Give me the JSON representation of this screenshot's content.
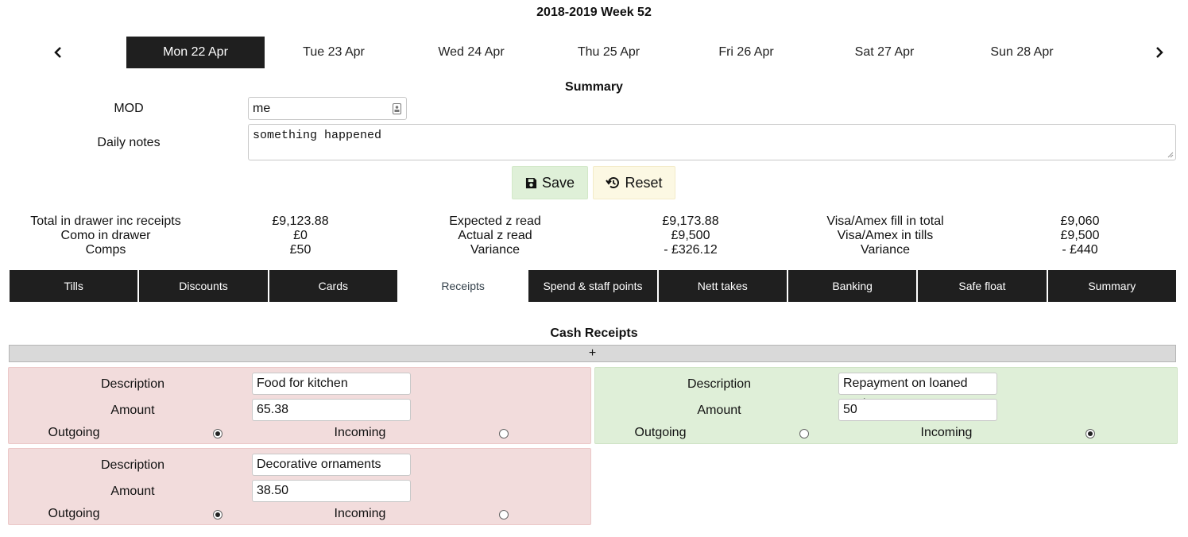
{
  "header": {
    "title": "2018-2019 Week 52"
  },
  "days": [
    {
      "label": "Mon 22 Apr"
    },
    {
      "label": "Tue 23 Apr"
    },
    {
      "label": "Wed 24 Apr"
    },
    {
      "label": "Thu 25 Apr"
    },
    {
      "label": "Fri 26 Apr"
    },
    {
      "label": "Sat 27 Apr"
    },
    {
      "label": "Sun 28 Apr"
    }
  ],
  "summary": {
    "heading": "Summary",
    "mod_label": "MOD",
    "mod_value": "me",
    "notes_label": "Daily notes",
    "notes_value": "something happened",
    "save_label": "Save",
    "reset_label": "Reset"
  },
  "stats": {
    "col1": [
      {
        "label": "Total in drawer inc receipts",
        "value": "£9,123.88"
      },
      {
        "label": "Como in drawer",
        "value": "£0"
      },
      {
        "label": "Comps",
        "value": "£50"
      }
    ],
    "col2": [
      {
        "label": "Expected z read",
        "value": "£9,173.88"
      },
      {
        "label": "Actual z read",
        "value": "£9,500"
      },
      {
        "label": "Variance",
        "value": "- £326.12"
      }
    ],
    "col3": [
      {
        "label": "Visa/Amex fill in total",
        "value": "£9,060"
      },
      {
        "label": "Visa/Amex in tills",
        "value": "£9,500"
      },
      {
        "label": "Variance",
        "value": "- £440"
      }
    ]
  },
  "tabs": [
    {
      "label": "Tills"
    },
    {
      "label": "Discounts"
    },
    {
      "label": "Cards"
    },
    {
      "label": "Receipts"
    },
    {
      "label": "Spend & staff points"
    },
    {
      "label": "Nett takes"
    },
    {
      "label": "Banking"
    },
    {
      "label": "Safe float"
    },
    {
      "label": "Summary"
    }
  ],
  "receipts": {
    "heading": "Cash Receipts",
    "add_label": "+",
    "description_label": "Description",
    "amount_label": "Amount",
    "outgoing_label": "Outgoing",
    "incoming_label": "Incoming",
    "items": [
      {
        "description": "Food for kitchen",
        "amount": "65.38",
        "direction": "outgoing"
      },
      {
        "description": "Repayment on loaned cash",
        "amount": "50",
        "direction": "incoming"
      },
      {
        "description": "Decorative ornaments",
        "amount": "38.50",
        "direction": "outgoing"
      }
    ]
  },
  "colors": {
    "active_bg": "#1f1f1f",
    "save_bg": "#dff0d8",
    "reset_bg": "#fcf8e3",
    "outgoing_bg": "#f2dcdc",
    "incoming_bg": "#dfefd8"
  }
}
